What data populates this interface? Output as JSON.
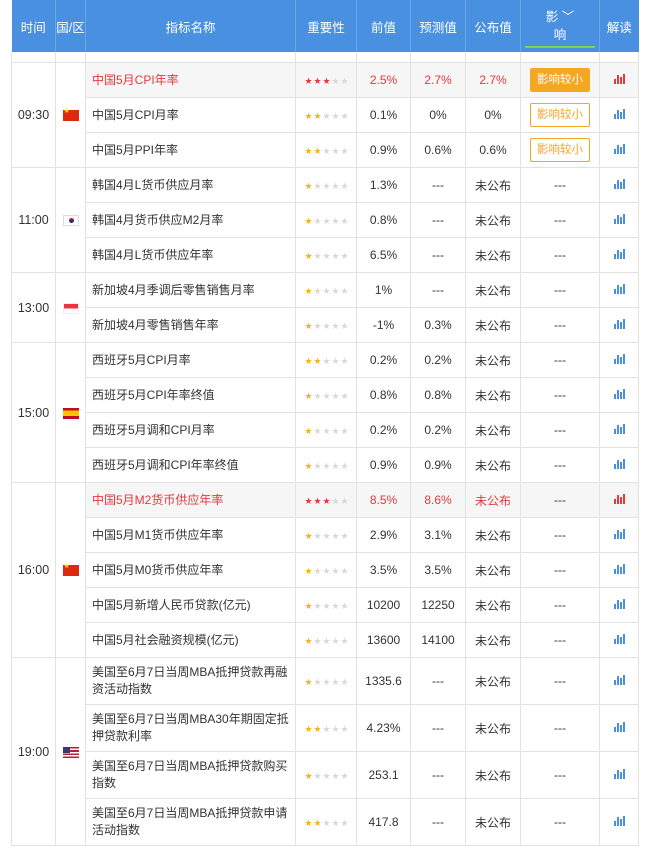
{
  "header": {
    "time": "时间",
    "region": "国/区",
    "name": "指标名称",
    "importance": "重要性",
    "prev": "前值",
    "forecast": "预测值",
    "actual": "公布值",
    "impact_line1": "影 ",
    "impact_line2": "响",
    "interpret": "解读"
  },
  "colors": {
    "header_bg": "#4a90e0",
    "highlight": "#e4393c",
    "star": "#f5b21c",
    "impact": "#f5a623"
  },
  "groups": [
    {
      "time": "09:30",
      "flag": "flag-cn",
      "flag_icon": "china-flag-icon",
      "rows": [
        {
          "name": "中国5月CPI年率",
          "stars": 3,
          "prev": "2.5%",
          "forecast": "2.7%",
          "actual": "2.7%",
          "impact": "影响较小",
          "impact_style": "filled",
          "hl": true
        },
        {
          "name": "中国5月CPI月率",
          "stars": 2,
          "prev": "0.1%",
          "forecast": "0%",
          "actual": "0%",
          "impact": "影响较小",
          "impact_style": "outline"
        },
        {
          "name": "中国5月PPI年率",
          "stars": 2,
          "prev": "0.9%",
          "forecast": "0.6%",
          "actual": "0.6%",
          "impact": "影响较小",
          "impact_style": "outline"
        }
      ]
    },
    {
      "time": "11:00",
      "flag": "flag-kr",
      "flag_icon": "south-korea-flag-icon",
      "rows": [
        {
          "name": "韩国4月L货币供应月率",
          "stars": 1,
          "prev": "1.3%",
          "forecast": "---",
          "actual": "未公布",
          "impact": "---"
        },
        {
          "name": "韩国4月货币供应M2月率",
          "stars": 1,
          "prev": "0.8%",
          "forecast": "---",
          "actual": "未公布",
          "impact": "---"
        },
        {
          "name": "韩国4月L货币供应年率",
          "stars": 1,
          "prev": "6.5%",
          "forecast": "---",
          "actual": "未公布",
          "impact": "---"
        }
      ]
    },
    {
      "time": "13:00",
      "flag": "flag-sg",
      "flag_icon": "singapore-flag-icon",
      "rows": [
        {
          "name": "新加坡4月季调后零售销售月率",
          "stars": 1,
          "prev": "1%",
          "forecast": "---",
          "actual": "未公布",
          "impact": "---"
        },
        {
          "name": "新加坡4月零售销售年率",
          "stars": 1,
          "prev": "-1%",
          "forecast": "0.3%",
          "actual": "未公布",
          "impact": "---"
        }
      ]
    },
    {
      "time": "15:00",
      "flag": "flag-es",
      "flag_icon": "spain-flag-icon",
      "rows": [
        {
          "name": "西班牙5月CPI月率",
          "stars": 2,
          "prev": "0.2%",
          "forecast": "0.2%",
          "actual": "未公布",
          "impact": "---"
        },
        {
          "name": "西班牙5月CPI年率终值",
          "stars": 1,
          "prev": "0.8%",
          "forecast": "0.8%",
          "actual": "未公布",
          "impact": "---"
        },
        {
          "name": "西班牙5月调和CPI月率",
          "stars": 1,
          "prev": "0.2%",
          "forecast": "0.2%",
          "actual": "未公布",
          "impact": "---"
        },
        {
          "name": "西班牙5月调和CPI年率终值",
          "stars": 1,
          "prev": "0.9%",
          "forecast": "0.9%",
          "actual": "未公布",
          "impact": "---"
        }
      ]
    },
    {
      "time": "16:00",
      "flag": "flag-cn",
      "flag_icon": "china-flag-icon",
      "rows": [
        {
          "name": "中国5月M2货币供应年率",
          "stars": 3,
          "prev": "8.5%",
          "forecast": "8.6%",
          "actual": "未公布",
          "impact": "---",
          "hl": true
        },
        {
          "name": "中国5月M1货币供应年率",
          "stars": 1,
          "prev": "2.9%",
          "forecast": "3.1%",
          "actual": "未公布",
          "impact": "---"
        },
        {
          "name": "中国5月M0货币供应年率",
          "stars": 1,
          "prev": "3.5%",
          "forecast": "3.5%",
          "actual": "未公布",
          "impact": "---"
        },
        {
          "name": "中国5月新增人民币贷款(亿元)",
          "stars": 1,
          "prev": "10200",
          "forecast": "12250",
          "actual": "未公布",
          "impact": "---"
        },
        {
          "name": "中国5月社会融资规模(亿元)",
          "stars": 1,
          "prev": "13600",
          "forecast": "14100",
          "actual": "未公布",
          "impact": "---"
        }
      ]
    },
    {
      "time": "19:00",
      "flag": "flag-us",
      "flag_icon": "usa-flag-icon",
      "rows": [
        {
          "name": "美国至6月7日当周MBA抵押贷款再融资活动指数",
          "stars": 1,
          "prev": "1335.6",
          "forecast": "---",
          "actual": "未公布",
          "impact": "---",
          "tall": true
        },
        {
          "name": "美国至6月7日当周MBA30年期固定抵押贷款利率",
          "stars": 2,
          "prev": "4.23%",
          "forecast": "---",
          "actual": "未公布",
          "impact": "---",
          "tall": true
        },
        {
          "name": "美国至6月7日当周MBA抵押贷款购买指数",
          "stars": 1,
          "prev": "253.1",
          "forecast": "---",
          "actual": "未公布",
          "impact": "---",
          "tall": true
        },
        {
          "name": "美国至6月7日当周MBA抵押贷款申请活动指数",
          "stars": 2,
          "prev": "417.8",
          "forecast": "---",
          "actual": "未公布",
          "impact": "---",
          "tall": true
        }
      ]
    }
  ]
}
